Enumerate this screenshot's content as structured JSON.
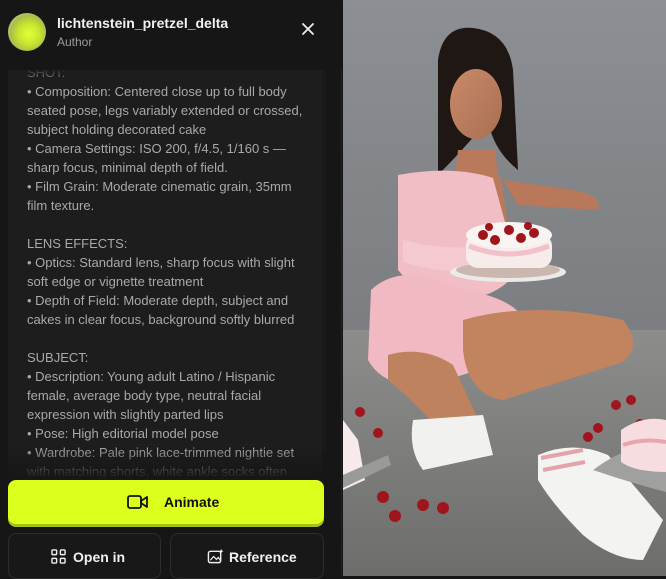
{
  "author": {
    "name": "lichtenstein_pretzel_delta",
    "role": "Author"
  },
  "prompt_lines": [
    "SHOT:",
    "• Composition: Centered close up to full body",
    "seated pose, legs variably extended or crossed,",
    "subject holding decorated cake",
    "• Camera Settings: ISO 200, f/4.5, 1/160 s —",
    "sharp focus, minimal depth of field.",
    "• Film Grain: Moderate cinematic grain, 35mm",
    "film texture.",
    "",
    "LENS EFFECTS:",
    "• Optics: Standard lens, sharp focus with slight",
    "soft edge or vignette treatment",
    "• Depth of Field: Moderate depth, subject and",
    "cakes in clear focus, background softly blurred",
    "",
    "SUBJECT:",
    "• Description: Young adult Latino / Hispanic",
    "female, average body type, neutral facial",
    "expression with slightly parted lips",
    "• Pose: High editorial model pose",
    "• Wardrobe: Pale pink lace-trimmed nightie set",
    "with matching shorts, white ankle socks often"
  ],
  "buttons": {
    "animate": "Animate",
    "open_in": "Open in",
    "reference": "Reference"
  },
  "icons": {
    "close": "close-icon",
    "animate": "video-camera-icon",
    "open_in": "grid-icon",
    "reference": "image-sparkle-icon"
  },
  "colors": {
    "accent": "#dcff1e",
    "panel": "#161616",
    "text": "#a9a9a9"
  }
}
